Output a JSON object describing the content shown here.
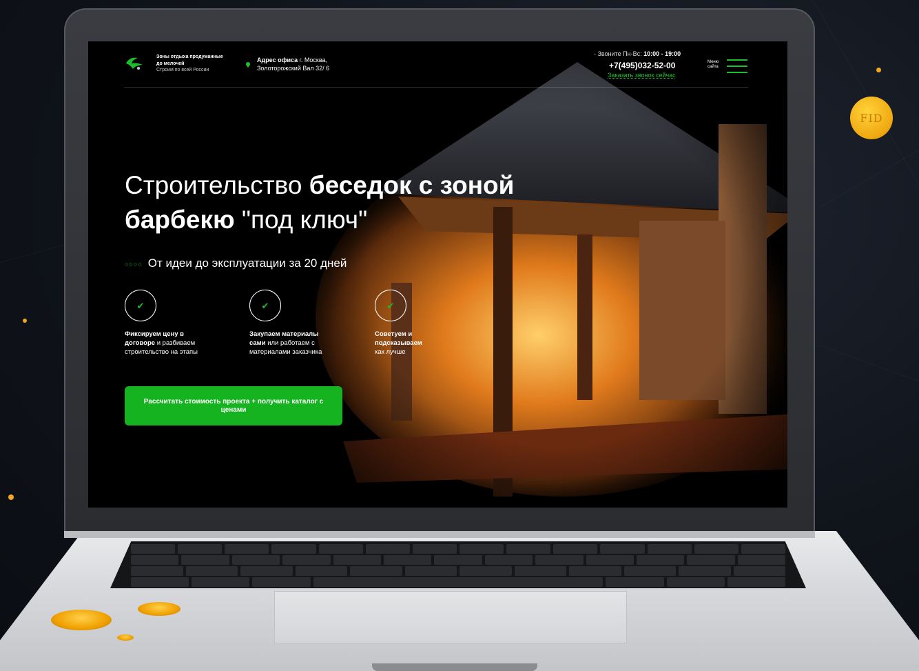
{
  "header": {
    "tagline_line1": "Зоны отдыха продуманные",
    "tagline_line2": "до мелочей",
    "tagline_line3": "Строим по всей России",
    "address_label": "Адрес офиса",
    "address_text_1": " г. Москва,",
    "address_text_2": "Золоторожский Вал 32/ 6",
    "hours_prefix": "- Звоните Пн-Вс:",
    "hours_value": " 10:00 - 19:00",
    "phone": "+7(495)032-52-00",
    "callback_link": "Заказать звонок сейчас",
    "menu_label_1": "Меню",
    "menu_label_2": "сайта",
    "accent_color": "#1bbf2c"
  },
  "hero": {
    "title_regular_1": "Строительство ",
    "title_bold_1": "беседок с зоной",
    "title_bold_2": "барбекю",
    "title_regular_2": " \"под ключ\"",
    "subtitle_dots": "○○○○",
    "subtitle": "От идеи до эксплуатации за 20 дней"
  },
  "features": [
    {
      "icon": "check-icon",
      "bold_1": "Фиксируем цену в",
      "bold_2": "договоре",
      "text_1": " и разбиваем",
      "text_2": "строительство на этапы"
    },
    {
      "icon": "check-icon",
      "bold_1": "Закупаем материалы",
      "bold_2": "сами",
      "text_1": " или работаем с",
      "text_2": "материалами заказчика"
    },
    {
      "icon": "check-icon",
      "bold_1": "Советуем и",
      "bold_2": "подсказываем",
      "text_1": "",
      "text_2": "как лучше"
    }
  ],
  "cta": {
    "label": "Рассчитать стоимость проекта + получить каталог с ценами"
  },
  "decor": {
    "coin_text": "FID",
    "coin_color": "#f2a81d"
  }
}
